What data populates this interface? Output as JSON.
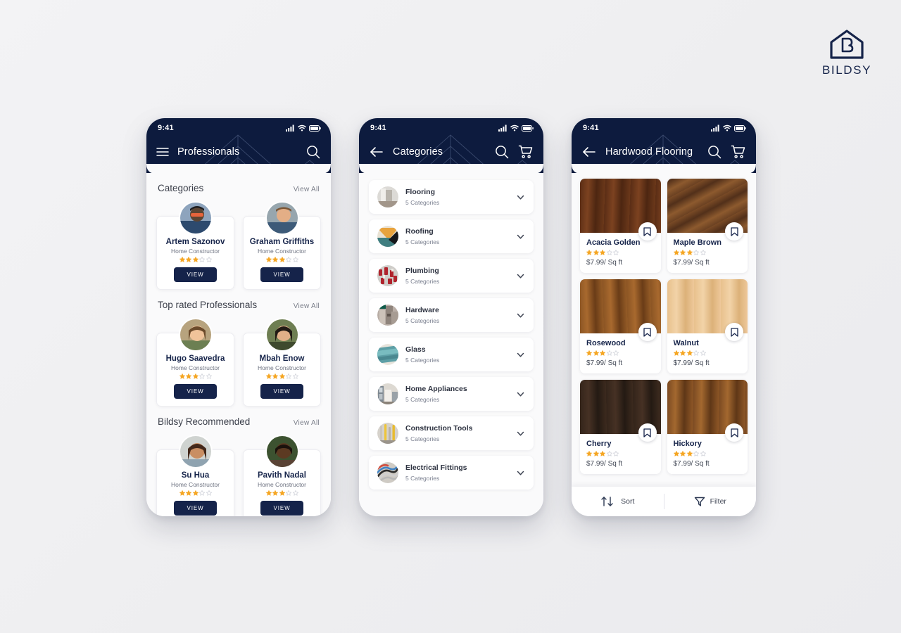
{
  "brand": {
    "word": "BILDSY",
    "mark_icon": "house-b-logo-icon",
    "color": "#16244a"
  },
  "theme": {
    "navy": "#0d1b3e",
    "accent_star": "#f5a623",
    "page_bg": "#f0f0f2"
  },
  "phones": [
    {
      "status": {
        "time": "9:41",
        "signal_icon": "signal-bars-icon",
        "wifi_icon": "wifi-icon",
        "battery_icon": "battery-icon"
      },
      "header": {
        "title": "Professionals",
        "left_icon": "hamburger-menu-icon",
        "right_icons": [
          "search-icon"
        ]
      },
      "sections": [
        {
          "title": "Categories",
          "link": "View  All",
          "cards": [
            {
              "name": "Artem Sazonov",
              "role": "Home Constructor",
              "rating": 3,
              "max_rating": 5,
              "button": "VIEW",
              "avatar": "avatar-artem"
            },
            {
              "name": "Graham Griffiths",
              "role": "Home Constructor",
              "rating": 3,
              "max_rating": 5,
              "button": "VIEW",
              "avatar": "avatar-graham"
            }
          ]
        },
        {
          "title": "Top rated Professionals",
          "link": "View  All",
          "cards": [
            {
              "name": "Hugo Saavedra",
              "role": "Home Constructor",
              "rating": 3,
              "max_rating": 5,
              "button": "VIEW",
              "avatar": "avatar-hugo"
            },
            {
              "name": "Mbah Enow",
              "role": "Home Constructor",
              "rating": 3,
              "max_rating": 5,
              "button": "VIEW",
              "avatar": "avatar-mbah"
            }
          ]
        },
        {
          "title": "Bildsy Recommended",
          "link": "View  All",
          "cards": [
            {
              "name": "Su Hua",
              "role": "Home Constructor",
              "rating": 3,
              "max_rating": 5,
              "button": "VIEW",
              "avatar": "avatar-suhua"
            },
            {
              "name": "Pavith Nadal",
              "role": "Home Constructor",
              "rating": 3,
              "max_rating": 5,
              "button": "VIEW",
              "avatar": "avatar-pavith"
            }
          ]
        }
      ]
    },
    {
      "status": {
        "time": "9:41",
        "signal_icon": "signal-bars-icon",
        "wifi_icon": "wifi-icon",
        "battery_icon": "battery-icon"
      },
      "header": {
        "title": "Categories",
        "left_icon": "back-arrow-icon",
        "right_icons": [
          "search-icon",
          "cart-icon"
        ]
      },
      "rows": [
        {
          "title": "Flooring",
          "sub": "5 Categories",
          "thumb": "thumb-flooring",
          "chevron": "chevron-down-icon"
        },
        {
          "title": "Roofing",
          "sub": "5 Categories",
          "thumb": "thumb-roofing",
          "chevron": "chevron-down-icon"
        },
        {
          "title": "Plumbing",
          "sub": "5 Categories",
          "thumb": "thumb-plumbing",
          "chevron": "chevron-down-icon"
        },
        {
          "title": "Hardware",
          "sub": "5 Categories",
          "thumb": "thumb-hardware",
          "chevron": "chevron-down-icon"
        },
        {
          "title": "Glass",
          "sub": "5 Categories",
          "thumb": "thumb-glass",
          "chevron": "chevron-down-icon"
        },
        {
          "title": "Home Appliances",
          "sub": "5 Categories",
          "thumb": "thumb-home-appliances",
          "chevron": "chevron-down-icon"
        },
        {
          "title": "Construction Tools",
          "sub": "5 Categories",
          "thumb": "thumb-construction-tools",
          "chevron": "chevron-down-icon"
        },
        {
          "title": "Electrical Fittings",
          "sub": "5 Categories",
          "thumb": "thumb-electrical-fittings",
          "chevron": "chevron-down-icon"
        }
      ]
    },
    {
      "status": {
        "time": "9:41",
        "signal_icon": "signal-bars-icon",
        "wifi_icon": "wifi-icon",
        "battery_icon": "battery-icon"
      },
      "header": {
        "title": "Hardwood Flooring",
        "left_icon": "back-arrow-icon",
        "right_icons": [
          "search-icon",
          "cart-icon"
        ]
      },
      "products": [
        {
          "name": "Acacia Golden",
          "price": "$7.99/ Sq ft",
          "rating": 3,
          "max_rating": 5,
          "bookmark": "bookmark-icon",
          "swatch": "wood-acacia-golden"
        },
        {
          "name": "Maple Brown",
          "price": "$7.99/ Sq ft",
          "rating": 3,
          "max_rating": 5,
          "bookmark": "bookmark-icon",
          "swatch": "wood-maple-brown"
        },
        {
          "name": "Rosewood",
          "price": "$7.99/ Sq ft",
          "rating": 3,
          "max_rating": 5,
          "bookmark": "bookmark-icon",
          "swatch": "wood-rosewood"
        },
        {
          "name": "Walnut",
          "price": "$7.99/ Sq ft",
          "rating": 3,
          "max_rating": 5,
          "bookmark": "bookmark-icon",
          "swatch": "wood-walnut"
        },
        {
          "name": "Cherry",
          "price": "$7.99/ Sq ft",
          "rating": 3,
          "max_rating": 5,
          "bookmark": "bookmark-icon",
          "swatch": "wood-cherry"
        },
        {
          "name": "Hickory",
          "price": "$7.99/ Sq ft",
          "rating": 3,
          "max_rating": 5,
          "bookmark": "bookmark-icon",
          "swatch": "wood-hickory"
        }
      ],
      "bottombar": [
        {
          "label": "Sort",
          "icon": "sort-arrows-icon"
        },
        {
          "label": "Filter",
          "icon": "filter-funnel-icon"
        }
      ]
    }
  ]
}
